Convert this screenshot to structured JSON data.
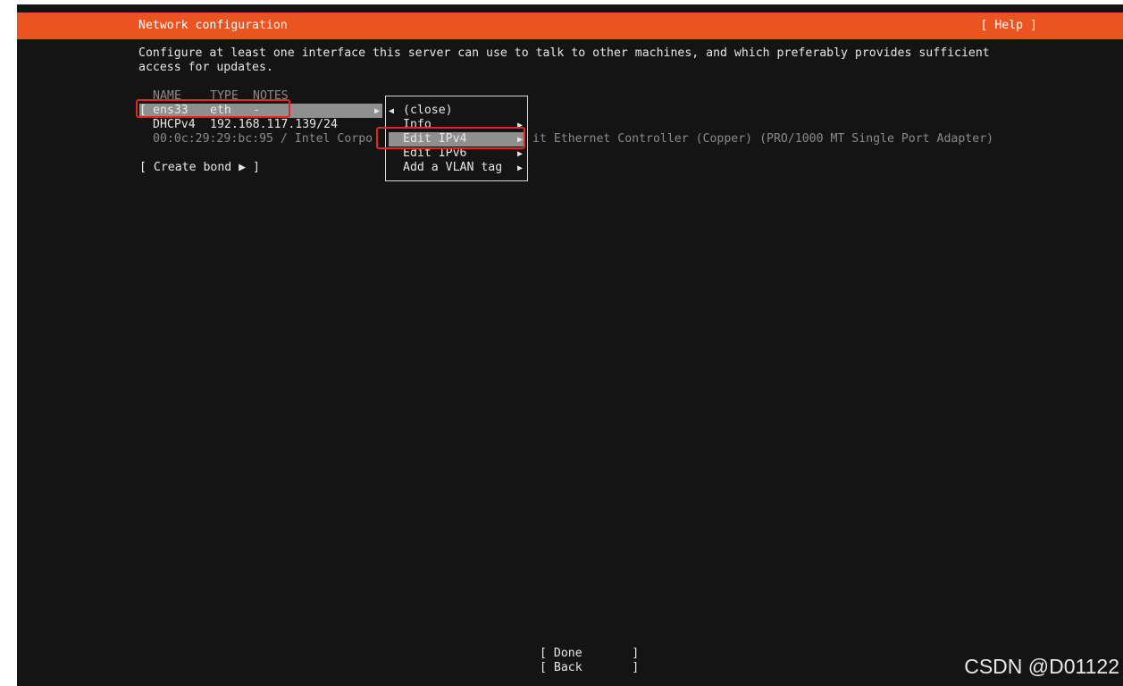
{
  "header": {
    "title": "Network configuration",
    "help": "[ Help ]"
  },
  "intro": {
    "line1": "Configure at least one interface this server can use to talk to other machines, and which preferably provides sufficient",
    "line2": "access for updates."
  },
  "table": {
    "columns": [
      "NAME",
      "TYPE",
      "NOTES"
    ],
    "row": {
      "bracket": "[",
      "name": "ens33",
      "type": "eth",
      "notes": "-",
      "arrow": "▶"
    },
    "dhcp_label": "DHCPv4",
    "dhcp_address": "192.168.117.139/24",
    "mac_left": "00:0c:29:29:bc:95 / Intel Corpo",
    "mac_right": "it Ethernet Controller (Copper) (PRO/1000 MT Single Port Adapter)"
  },
  "create_bond": "[ Create bond ▶ ]",
  "popup_menu": {
    "close_arrow": "◀",
    "close": "(close)",
    "items": [
      {
        "label": "Info",
        "arrow": "▶"
      },
      {
        "label": "Edit IPv4",
        "arrow": "▶",
        "selected": true
      },
      {
        "label": "Edit IPv6",
        "arrow": "▶"
      },
      {
        "label": "Add a VLAN tag",
        "arrow": "▶"
      }
    ]
  },
  "footer": {
    "done": "[ Done       ]",
    "back": "[ Back       ]"
  },
  "watermark": "CSDN @D01122",
  "colors": {
    "header_bg": "#e95420",
    "background": "#141414",
    "highlight": "#8f8f8f",
    "annotation": "#e0281e"
  }
}
